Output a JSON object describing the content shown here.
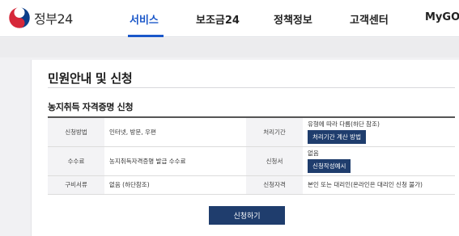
{
  "header": {
    "logo_text": "정부24",
    "nav": [
      "서비스",
      "보조금24",
      "정책정보",
      "고객센터",
      "MyGOV"
    ]
  },
  "page": {
    "title": "민원안내 및 신청",
    "section_title": "농지취득 자격증명 신청"
  },
  "table": {
    "row1": {
      "label1": "신청방법",
      "value1": "인터넷, 방문, 우편",
      "label2": "처리기간",
      "value2": "유형에 따라 다름(하단 참조)",
      "button": "처리기간 계산 방법"
    },
    "row2": {
      "label1": "수수료",
      "value1": "농지취득자격증명 발급 수수료",
      "label2": "신청서",
      "value2": "없음",
      "button": "신청작성예시"
    },
    "row3": {
      "label1": "구비서류",
      "value1": "없음 (하단참조)",
      "label2": "신청자격",
      "value2": "본인 또는 대리인(온라인은 대리인 신청 불가)"
    }
  },
  "apply_button": "신청하기",
  "colors": {
    "accent": "#1a57c9",
    "button_navy": "#1f3d6d"
  }
}
